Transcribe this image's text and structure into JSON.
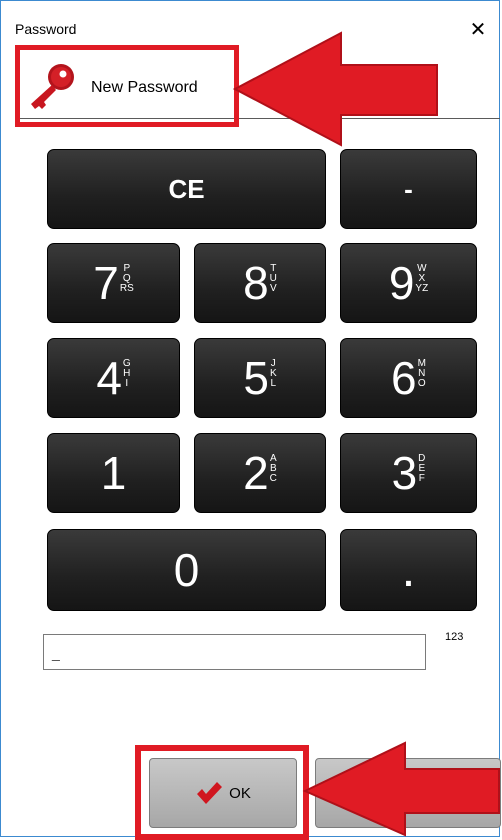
{
  "window": {
    "title": "Password",
    "close_glyph": "✕"
  },
  "header": {
    "icon": "key-icon",
    "label": "New Password"
  },
  "keypad": {
    "clear": "CE",
    "minus": "-",
    "keys": [
      {
        "digit": "7",
        "letters": [
          "P",
          "Q",
          "RS"
        ]
      },
      {
        "digit": "8",
        "letters": [
          "T",
          "U",
          "V"
        ]
      },
      {
        "digit": "9",
        "letters": [
          "W",
          "X",
          "YZ"
        ]
      },
      {
        "digit": "4",
        "letters": [
          "G",
          "H",
          "I"
        ]
      },
      {
        "digit": "5",
        "letters": [
          "J",
          "K",
          "L"
        ]
      },
      {
        "digit": "6",
        "letters": [
          "M",
          "N",
          "O"
        ]
      },
      {
        "digit": "1",
        "letters": []
      },
      {
        "digit": "2",
        "letters": [
          "A",
          "B",
          "C"
        ]
      },
      {
        "digit": "3",
        "letters": [
          "D",
          "E",
          "F"
        ]
      }
    ],
    "zero": "0",
    "dot": "."
  },
  "input": {
    "value": "_",
    "keyboard_label": "123"
  },
  "footer": {
    "ok_label": "OK",
    "ok_icon": "checkmark-icon"
  },
  "colors": {
    "highlight": "#e01b24",
    "key_bg": "#262626",
    "window_border": "#3c8ad0"
  }
}
